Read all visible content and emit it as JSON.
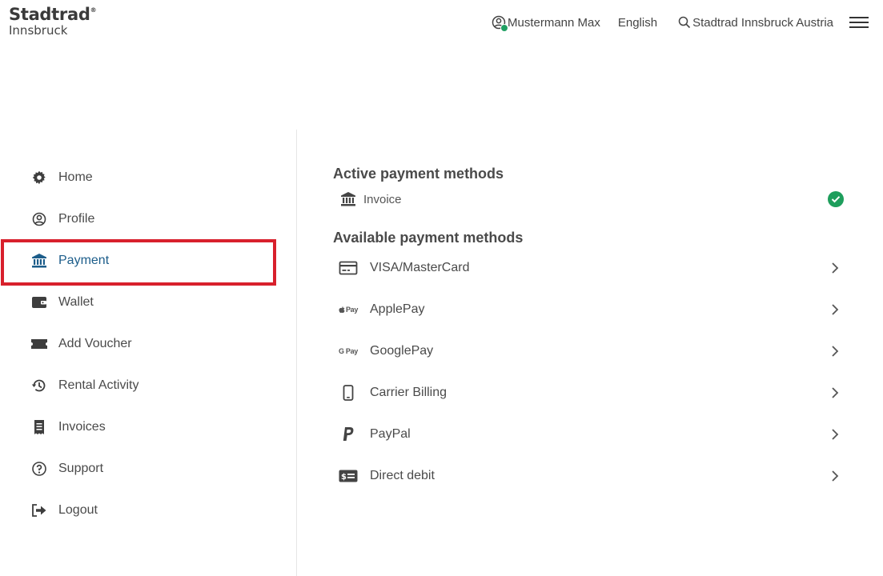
{
  "brand": {
    "name": "Stadtrad",
    "reg_mark": "®",
    "sub": "Innsbruck"
  },
  "topnav": {
    "user": "Mustermann Max",
    "language": "English",
    "city": "Stadtrad Innsbruck Austria"
  },
  "sidebar": {
    "items": [
      {
        "label": "Home",
        "icon": "gear-icon"
      },
      {
        "label": "Profile",
        "icon": "user-circle-icon"
      },
      {
        "label": "Payment",
        "icon": "bank-icon",
        "active": true
      },
      {
        "label": "Wallet",
        "icon": "wallet-icon"
      },
      {
        "label": "Add Voucher",
        "icon": "ticket-icon"
      },
      {
        "label": "Rental Activity",
        "icon": "history-icon"
      },
      {
        "label": "Invoices",
        "icon": "receipt-icon"
      },
      {
        "label": "Support",
        "icon": "help-icon"
      },
      {
        "label": "Logout",
        "icon": "logout-icon"
      }
    ]
  },
  "main": {
    "active_title": "Active payment methods",
    "active_methods": [
      {
        "label": "Invoice",
        "icon": "bank-icon",
        "status": "active"
      }
    ],
    "available_title": "Available payment methods",
    "available_methods": [
      {
        "label": "VISA/MasterCard",
        "icon": "credit-card-icon"
      },
      {
        "label": "ApplePay",
        "icon": "apple-pay-icon",
        "icon_text": "Pay"
      },
      {
        "label": "GooglePay",
        "icon": "google-pay-icon",
        "icon_text": "G Pay"
      },
      {
        "label": "Carrier Billing",
        "icon": "phone-icon"
      },
      {
        "label": "PayPal",
        "icon": "paypal-icon"
      },
      {
        "label": "Direct debit",
        "icon": "direct-debit-icon"
      }
    ]
  },
  "colors": {
    "accent": "#1c5d8a",
    "highlight": "#d8202c",
    "success": "#1e9e5c"
  }
}
